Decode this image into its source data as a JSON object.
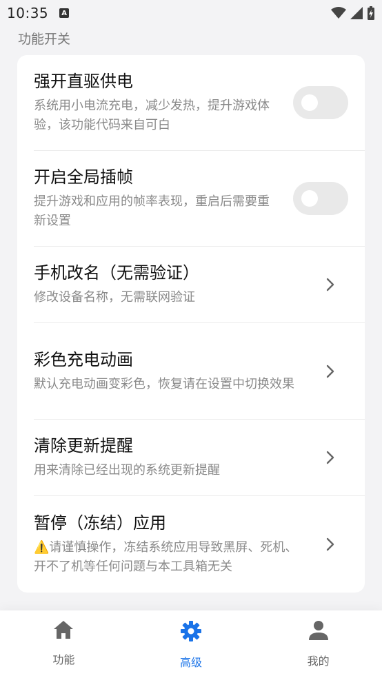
{
  "status_bar": {
    "time": "10:35",
    "notification_icon": "A"
  },
  "section": {
    "title": "功能开关"
  },
  "settings": [
    {
      "title": "强开直驱供电",
      "desc": "系统用小电流充电，减少发热，提升游戏体验，该功能代码来自可白",
      "control": "toggle",
      "enabled": false
    },
    {
      "title": "开启全局插帧",
      "desc": "提升游戏和应用的帧率表现，重启后需要重新设置",
      "control": "toggle",
      "enabled": false
    },
    {
      "title": "手机改名（无需验证）",
      "desc": "修改设备名称，无需联网验证",
      "control": "chevron"
    },
    {
      "title": "彩色充电动画",
      "desc": "默认充电动画变彩色，恢复请在设置中切换效果",
      "control": "chevron"
    },
    {
      "title": "清除更新提醒",
      "desc": "用来清除已经出现的系统更新提醒",
      "control": "chevron"
    },
    {
      "title": "暂停（冻结）应用",
      "desc": "⚠️请谨慎操作，冻结系统应用导致黑屏、死机、开不了机等任何问题与本工具箱无关",
      "control": "chevron"
    }
  ],
  "bottom_nav": [
    {
      "label": "功能",
      "icon": "home-icon",
      "active": false
    },
    {
      "label": "高级",
      "icon": "gear-icon",
      "active": true
    },
    {
      "label": "我的",
      "icon": "person-icon",
      "active": false
    }
  ],
  "colors": {
    "accent": "#1a73e8",
    "inactive": "#666666",
    "background": "#f3f3f5"
  }
}
